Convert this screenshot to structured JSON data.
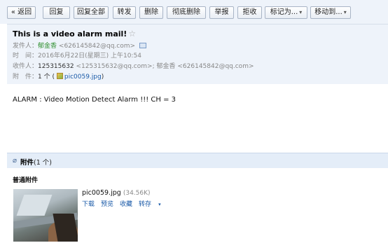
{
  "toolbar": {
    "back": "« 返回",
    "reply": "回复",
    "reply_all": "回复全部",
    "forward": "转发",
    "delete": "删除",
    "perm_delete": "彻底删除",
    "report": "举报",
    "reject": "拒收",
    "mark_as": "标记为...",
    "move_to": "移动到..."
  },
  "mail": {
    "subject": "This is a video alarm mail!",
    "sender_label": "发件人：",
    "sender_name": "郁金香",
    "sender_email": "<626145842@qq.com>",
    "time_label": "时　间：",
    "time_value": "2016年6月22日(星期三) 上午10:54",
    "recipients_label": "收件人：",
    "recipient1_name": "125315632",
    "recipient1_email": "<125315632@qq.com>;",
    "recipient2_name": "郁金香",
    "recipient2_email": "<626145842@qq.com>",
    "attach_label": "附　件：",
    "attach_count": "1 个 (",
    "attach_file": "pic0059.jpg",
    "attach_close": ")"
  },
  "body": {
    "text": "ALARM : Video Motion Detect Alarm !!! CH = 3"
  },
  "attachments": {
    "title": "附件",
    "count": "(1 个)",
    "section_label": "普通附件",
    "file_name": "pic0059.jpg",
    "file_size": "(34.56K)",
    "download": "下载",
    "preview": "预览",
    "save": "收藏",
    "share": "转存"
  },
  "icons": {
    "star": "star-icon",
    "contact": "contact-card-icon",
    "image": "image-file-icon",
    "paperclip": "paperclip-icon",
    "caret": "chevron-down-icon"
  }
}
